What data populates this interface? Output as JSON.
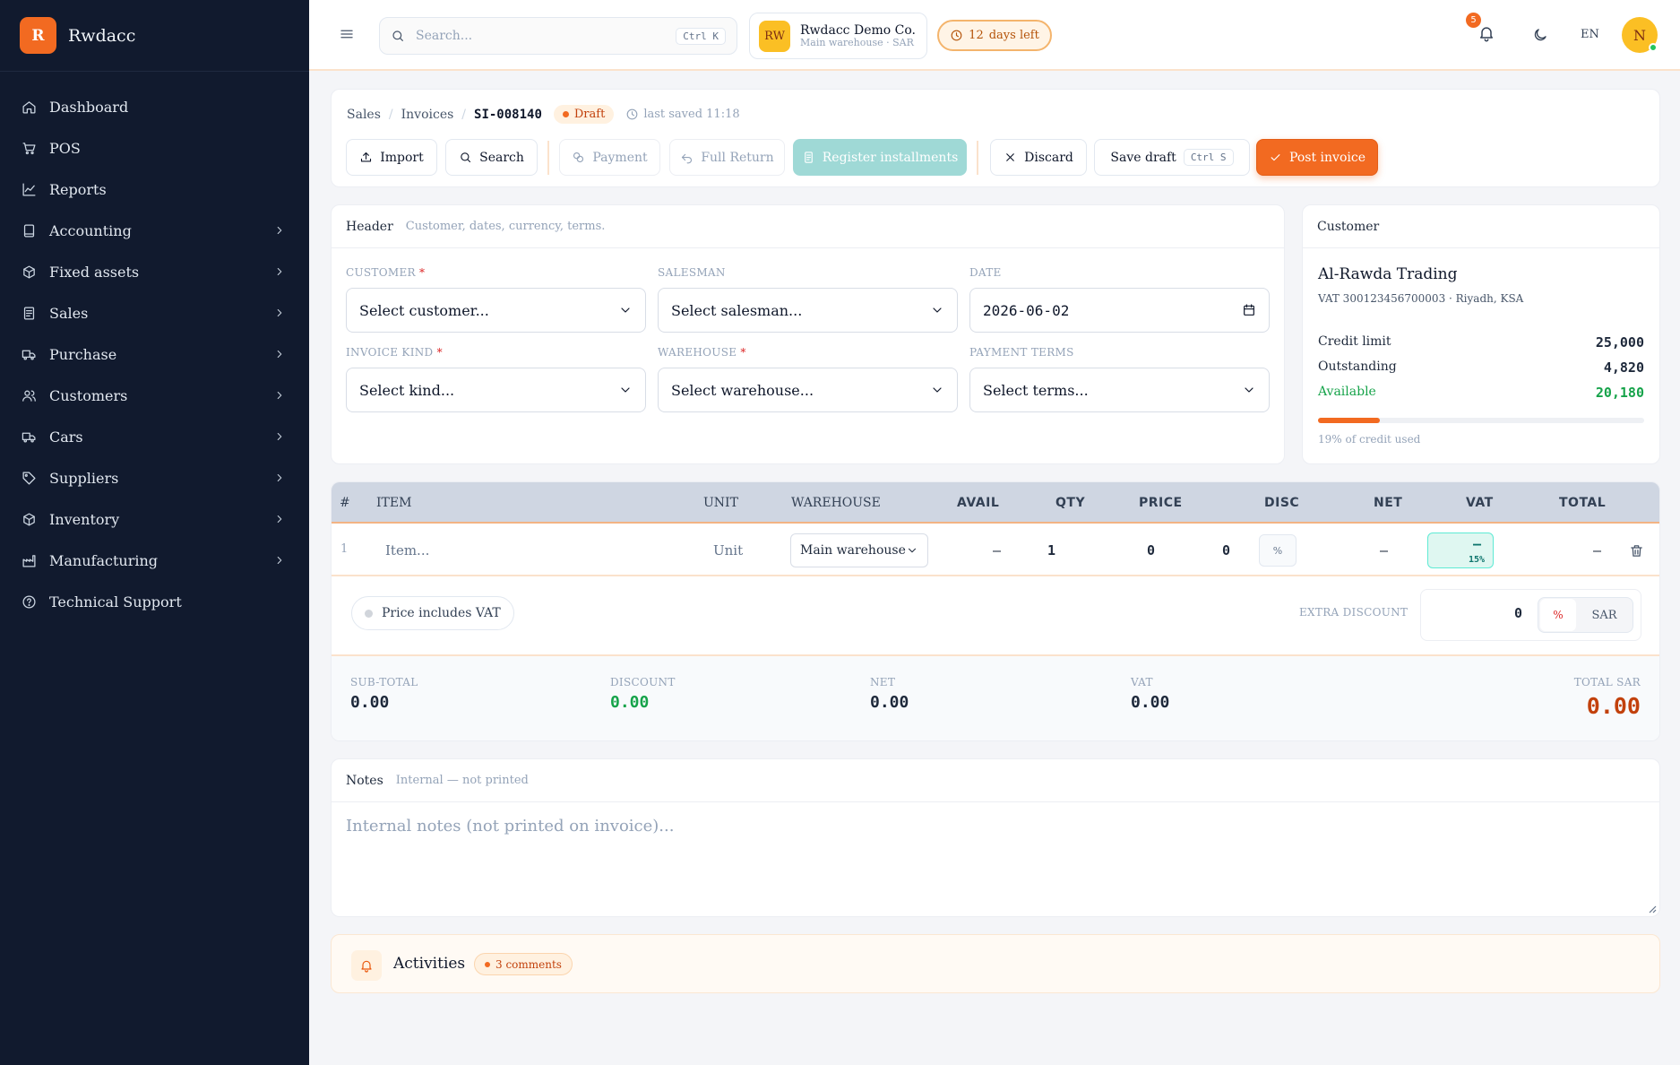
{
  "brand": {
    "logo_letter": "R",
    "name": "Rwdacc"
  },
  "sidebar": {
    "items": [
      {
        "label": "Dashboard",
        "icon": "home-icon",
        "has_children": false
      },
      {
        "label": "POS",
        "icon": "cart-icon",
        "has_children": false
      },
      {
        "label": "Reports",
        "icon": "chart-line-icon",
        "has_children": false
      },
      {
        "label": "Accounting",
        "icon": "book-icon",
        "has_children": true
      },
      {
        "label": "Fixed assets",
        "icon": "box-icon",
        "has_children": true
      },
      {
        "label": "Sales",
        "icon": "receipt-icon",
        "has_children": true
      },
      {
        "label": "Purchase",
        "icon": "truck-icon",
        "has_children": true
      },
      {
        "label": "Customers",
        "icon": "users-icon",
        "has_children": true
      },
      {
        "label": "Cars",
        "icon": "truck-icon",
        "has_children": true
      },
      {
        "label": "Suppliers",
        "icon": "tag-icon",
        "has_children": true
      },
      {
        "label": "Inventory",
        "icon": "box-icon",
        "has_children": true
      },
      {
        "label": "Manufacturing",
        "icon": "factory-icon",
        "has_children": true
      },
      {
        "label": "Technical Support",
        "icon": "help-circle-icon",
        "has_children": false
      }
    ]
  },
  "topbar": {
    "search_placeholder": "Search...",
    "search_shortcut": "Ctrl K",
    "company_initials": "RW",
    "company_name": "Rwdacc Demo Co.",
    "company_sub": "Main warehouse · SAR",
    "trial_days": "12",
    "trial_suffix": "days left",
    "notification_count": "5",
    "language": "EN",
    "user_initial": "N"
  },
  "breadcrumb": {
    "sales": "Sales",
    "invoices": "Invoices",
    "doc_no": "SI-008140"
  },
  "status": {
    "badge": "Draft",
    "last_saved": "last saved 11:18"
  },
  "actions": {
    "import": "Import",
    "search": "Search",
    "payment": "Payment",
    "full_return": "Full Return",
    "register_installments": "Register installments",
    "discard": "Discard",
    "save_draft": "Save draft",
    "save_shortcut": "Ctrl S",
    "post_invoice": "Post invoice"
  },
  "header_section": {
    "title": "Header",
    "subtitle": "Customer, dates, currency, terms.",
    "customer_label": "CUSTOMER",
    "customer_value": "Select customer...",
    "salesman_label": "SALESMAN",
    "salesman_value": "Select salesman...",
    "date_label": "DATE",
    "date_value": "2026-06-02",
    "kind_label": "INVOICE KIND",
    "kind_value": "Select kind...",
    "warehouse_label": "WAREHOUSE",
    "warehouse_value": "Select warehouse...",
    "terms_label": "PAYMENT TERMS",
    "terms_value": "Select terms...",
    "required_mark": "*"
  },
  "customer_panel": {
    "title": "Customer",
    "name": "Al-Rawda Trading",
    "vat_line": "VAT 300123456700003 · Riyadh, KSA",
    "credit_limit_label": "Credit limit",
    "credit_limit": "25,000",
    "outstanding_label": "Outstanding",
    "outstanding": "4,820",
    "available_label": "Available",
    "available": "20,180",
    "credit_used_fraction": 0.19,
    "credit_note": "19% of credit used"
  },
  "lines": {
    "columns": [
      "#",
      "ITEM",
      "UNIT",
      "WAREHOUSE",
      "AVAIL",
      "QTY",
      "PRICE",
      "DISC",
      "NET",
      "VAT",
      "TOTAL"
    ],
    "rows": [
      {
        "no": "1",
        "item": "Item...",
        "unit": "Unit",
        "warehouse": "Main warehouse",
        "avail": "—",
        "qty": "1",
        "price": "0",
        "disc": "0",
        "disc_unit": "%",
        "net": "—",
        "vat": "—",
        "vat_rate": "15%",
        "total": "—"
      }
    ],
    "price_includes_vat": "Price includes VAT",
    "extra_discount_label": "EXTRA DISCOUNT",
    "extra_discount_value": "0",
    "extra_discount_pct": "%",
    "extra_discount_currency": "SAR"
  },
  "totals": {
    "subtotal_label": "SUB-TOTAL",
    "subtotal": "0.00",
    "discount_label": "DISCOUNT",
    "discount": "0.00",
    "net_label": "NET",
    "net": "0.00",
    "vat_label": "VAT",
    "vat": "0.00",
    "total_label": "TOTAL SAR",
    "total": "0.00"
  },
  "notes": {
    "title": "Notes",
    "subtitle": "Internal — not printed",
    "placeholder": "Internal notes (not printed on invoice)..."
  },
  "activities": {
    "title": "Activities",
    "comments": "3 comments"
  },
  "colors": {
    "accent": "#f26a21",
    "sidebar_bg": "#111a2e",
    "success": "#16a34a",
    "teal": "#9fd9d6"
  }
}
